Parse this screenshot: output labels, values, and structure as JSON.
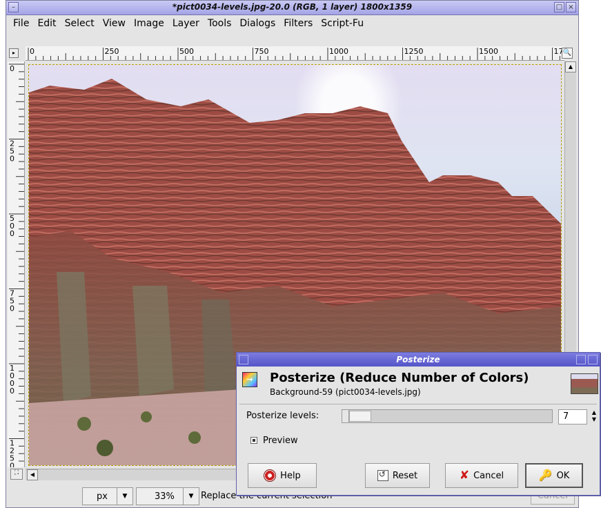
{
  "window": {
    "title": "*pict0034-levels.jpg-20.0 (RGB, 1 layer) 1800x1359",
    "menu": [
      "File",
      "Edit",
      "Select",
      "View",
      "Image",
      "Layer",
      "Tools",
      "Dialogs",
      "Filters",
      "Script-Fu"
    ]
  },
  "ruler_h": [
    "0",
    "250",
    "500",
    "750",
    "1000",
    "1250",
    "1500",
    "17"
  ],
  "ruler_v": [
    "0",
    "250",
    "500",
    "750",
    "1000",
    "1250"
  ],
  "status": {
    "unit": "px",
    "zoom": "33%",
    "message": "Replace the current selection",
    "cancel_label": "Cancel"
  },
  "dialog": {
    "title": "Posterize",
    "heading": "Posterize (Reduce Number of Colors)",
    "subtitle": "Background-59 (pict0034-levels.jpg)",
    "levels_label": "Posterize levels:",
    "levels_value": "7",
    "levels_fraction": 0.03,
    "preview_label": "Preview",
    "preview_checked": true,
    "buttons": {
      "help": "Help",
      "reset": "Reset",
      "cancel": "Cancel",
      "ok": "OK"
    }
  },
  "icons": {
    "help": "help-icon",
    "reset": "reset-icon",
    "cancel": "cancel-icon",
    "ok": "ok-icon",
    "thumb": "layer-thumbnail",
    "posterize": "posterize-icon"
  },
  "colors": {
    "title_gradient": "#a4a4e6",
    "dialog_title": "#5454c8",
    "rock": "#9a4a42"
  }
}
